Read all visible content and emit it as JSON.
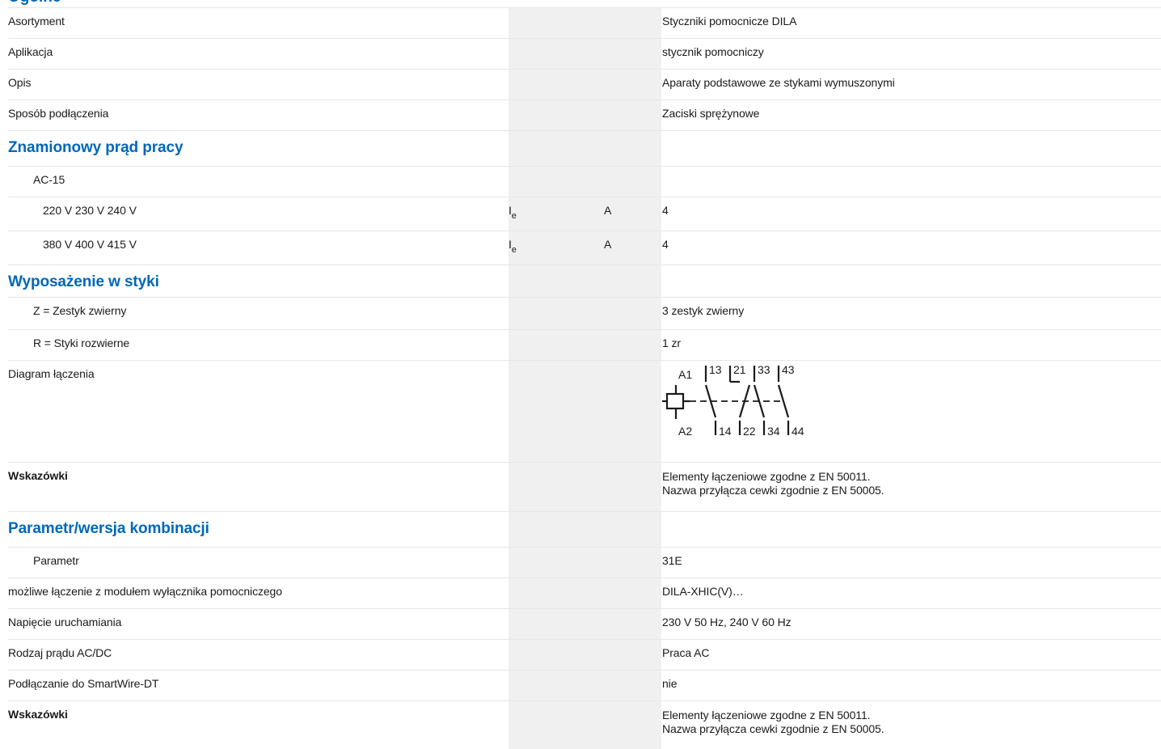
{
  "page": {
    "top_heading": "Ogólne"
  },
  "rows": {
    "asortyment": {
      "label": "Asortyment",
      "value": "Styczniki pomocnicze DILA"
    },
    "aplikacja": {
      "label": "Aplikacja",
      "value": "stycznik pomocniczy"
    },
    "opis": {
      "label": "Opis",
      "value": "Aparaty podstawowe ze stykami wymuszonymi"
    },
    "sposob": {
      "label": "Sposób podłączenia",
      "value": "Zaciski sprężynowe"
    },
    "section_prad": {
      "label": "Znamionowy prąd pracy"
    },
    "ac15": {
      "label": "AC-15"
    },
    "v220": {
      "label": "220 V 230 V 240 V",
      "symbol": "I",
      "symbol_sub": "e",
      "unit": "A",
      "value": "4"
    },
    "v380": {
      "label": "380 V 400 V 415 V",
      "symbol": "I",
      "symbol_sub": "e",
      "unit": "A",
      "value": "4"
    },
    "section_styki": {
      "label": "Wyposażenie w styki"
    },
    "zwierne": {
      "label": "Z = Zestyk zwierny",
      "value": "3 zestyk zwierny"
    },
    "rozwierne": {
      "label": "R = Styki rozwierne",
      "value": "1 zr"
    },
    "diagram": {
      "label": "Diagram łączenia",
      "terminals": {
        "a1": "A1",
        "a2": "A2",
        "t13": "13",
        "t14": "14",
        "t21": "21",
        "t22": "22",
        "t33": "33",
        "t34": "34",
        "t43": "43",
        "t44": "44"
      }
    },
    "wskazowki1": {
      "label": "Wskazówki",
      "line1": "Elementy łączeniowe zgodne z EN 50011.",
      "line2": "Nazwa przyłącza cewki zgodnie z EN 50005."
    },
    "section_param": {
      "label": "Parametr/wersja kombinacji"
    },
    "parametr": {
      "label": "Parametr",
      "value": "31E"
    },
    "modul": {
      "label": "możliwe łączenie z modułem wyłącznika pomocniczego",
      "value": "DILA-XHIC(V)…"
    },
    "napiecie": {
      "label": "Napięcie uruchamiania",
      "value": "230 V 50 Hz, 240 V 60 Hz"
    },
    "rodzaj": {
      "label": "Rodzaj prądu AC/DC",
      "value": "Praca AC"
    },
    "smartwire": {
      "label": "Podłączanie do SmartWire-DT",
      "value": "nie"
    },
    "wskazowki2": {
      "label": "Wskazówki",
      "line1": "Elementy łączeniowe zgodne z EN 50011.",
      "line2": "Nazwa przyłącza cewki zgodnie z EN 50005."
    }
  }
}
